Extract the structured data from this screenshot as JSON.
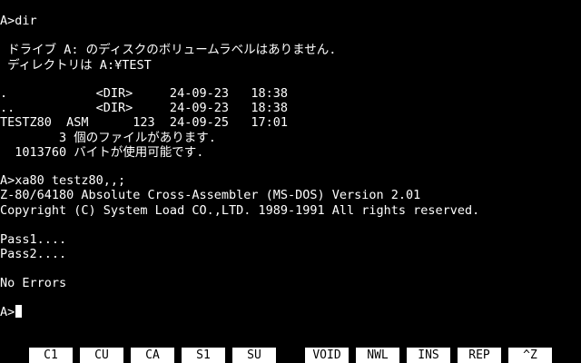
{
  "terminal": {
    "lines": [
      "A>dir",
      "",
      " ドライブ A: のディスクのボリュームラベルはありません.",
      " ディレクトリは A:¥TEST",
      "",
      ".            <DIR>     24-09-23   18:38",
      "..           <DIR>     24-09-23   18:38",
      "TESTZ80  ASM      123  24-09-25   17:01",
      "        3 個のファイルがあります.",
      "  1013760 バイトが使用可能です.",
      "",
      "A>xa80 testz80,,;",
      "Z-80/64180 Absolute Cross-Assembler (MS-DOS) Version 2.01",
      "Copyright (C) System Load CO.,LTD. 1989-1991 All rights reserved.",
      "",
      "Pass1....",
      "Pass2....",
      "",
      "No Errors",
      ""
    ],
    "prompt": "A>"
  },
  "function_keys": [
    "C1",
    "CU",
    "CA",
    "S1",
    "SU",
    "VOID",
    "NWL",
    "INS",
    "REP",
    "^Z"
  ],
  "colors": {
    "background": "#000000",
    "text": "#ffffff",
    "fkey_background": "#ffffff",
    "fkey_text": "#000000"
  }
}
